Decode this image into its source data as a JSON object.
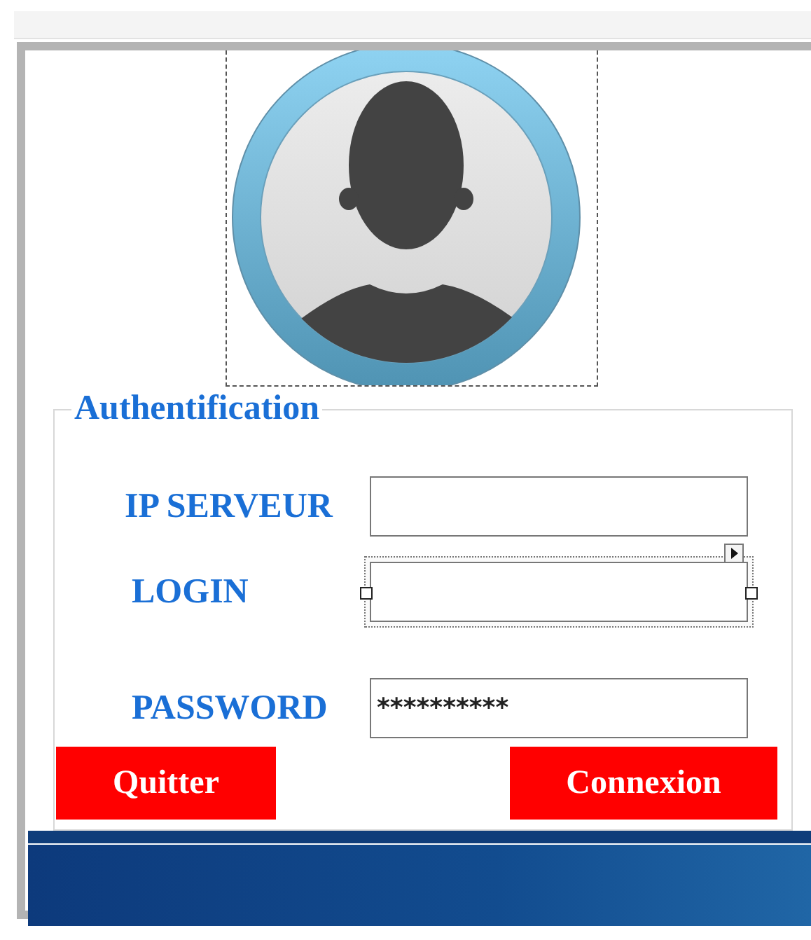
{
  "avatar": {
    "kind": "user-silhouette"
  },
  "auth_group": {
    "title": "Authentification",
    "fields": [
      {
        "label": "IP SERVEUR",
        "selected": false
      },
      {
        "label": "LOGIN",
        "selected": true
      },
      {
        "label": "PASSWORD",
        "value": "**********",
        "selected": false
      }
    ],
    "buttons": [
      {
        "label": "Quitter"
      },
      {
        "label": "Connexion"
      }
    ]
  },
  "footer_banner": {
    "kind": "gradient"
  }
}
